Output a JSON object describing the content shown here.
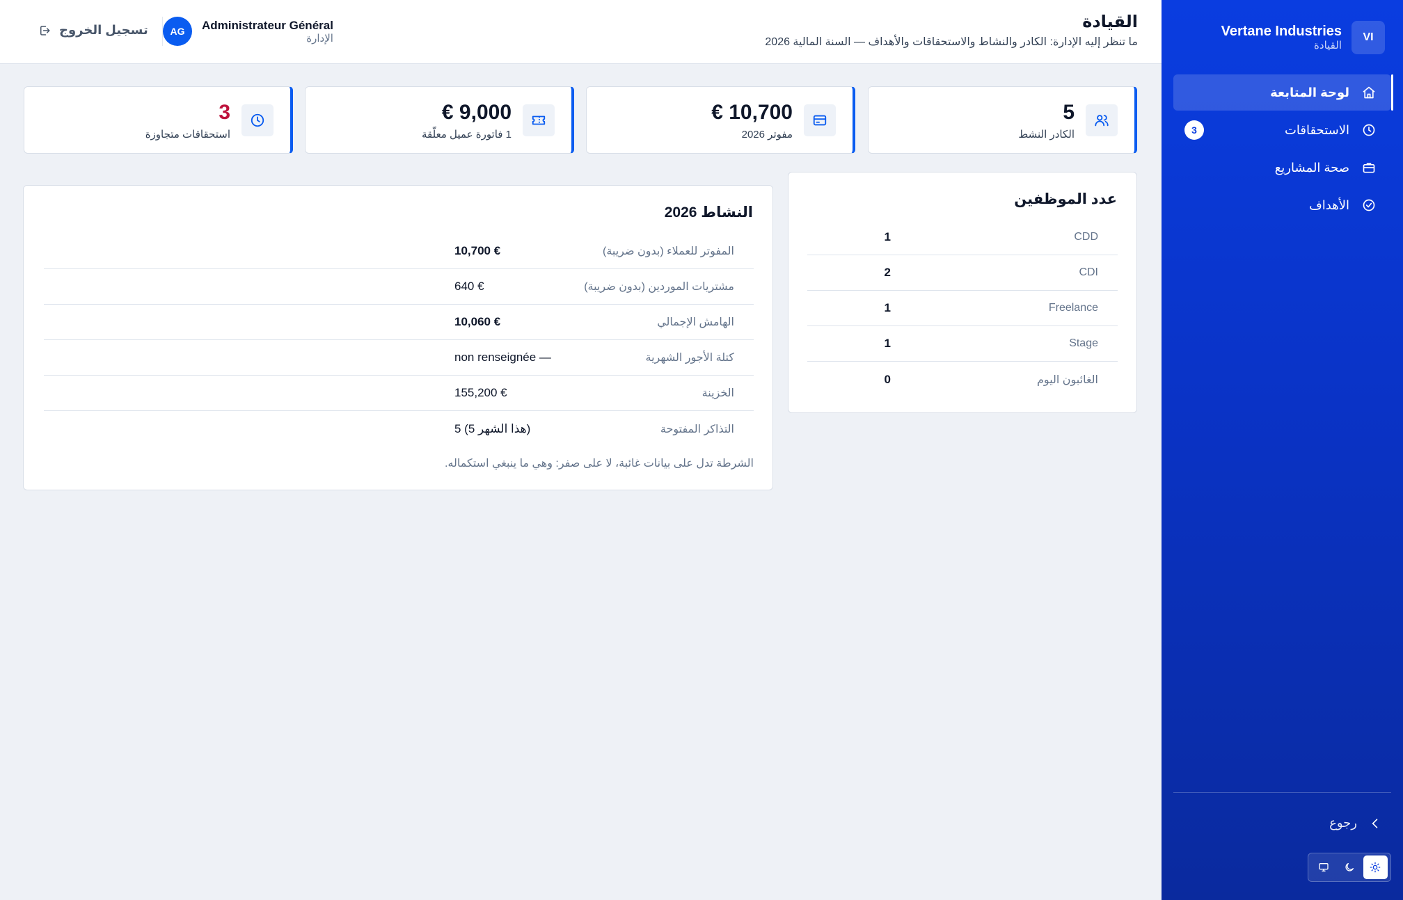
{
  "sidebar": {
    "brand_initials": "VI",
    "brand_name": "Vertane Industries",
    "brand_sub": "القيادة",
    "items": [
      {
        "label": "لوحة المتابعة",
        "icon": "home-icon",
        "active": true
      },
      {
        "label": "الاستحقاقات",
        "icon": "clock-icon",
        "badge": "3"
      },
      {
        "label": "صحة المشاريع",
        "icon": "briefcase-icon"
      },
      {
        "label": "الأهداف",
        "icon": "check-circle-icon"
      }
    ],
    "back_label": "رجوع",
    "theme_options": [
      "light",
      "dark",
      "system"
    ],
    "theme_selected": "light"
  },
  "header": {
    "title": "القيادة",
    "subtitle": "ما تنظر إليه الإدارة: الكادر والنشاط والاستحقاقات والأهداف — السنة المالية 2026",
    "user_initials": "AG",
    "user_name": "Administrateur Général",
    "user_role": "الإدارة",
    "logout_label": "تسجيل الخروج"
  },
  "stats": [
    {
      "value": "5",
      "label": "الكادر النشط",
      "icon": "users-icon"
    },
    {
      "value": "€ 10,700",
      "label": "مفوتر 2026",
      "icon": "credit-card-icon"
    },
    {
      "value": "€ 9,000",
      "label": "1 فاتورة عميل معلّقة",
      "icon": "ticket-icon"
    },
    {
      "value": "3",
      "label": "استحقاقات متجاوزة",
      "icon": "clock-icon",
      "alert": true
    }
  ],
  "headcount": {
    "title": "عدد الموظفين",
    "rows": [
      {
        "label": "CDD",
        "value": "1"
      },
      {
        "label": "CDI",
        "value": "2"
      },
      {
        "label": "Freelance",
        "value": "1"
      },
      {
        "label": "Stage",
        "value": "1"
      },
      {
        "label": "الغائبون اليوم",
        "value": "0"
      }
    ]
  },
  "activity": {
    "title": "النشاط 2026",
    "rows": [
      {
        "label": "المفوتر للعملاء (بدون ضريبة)",
        "value": "€ 10,700",
        "bold": true
      },
      {
        "label": "مشتريات الموردين (بدون ضريبة)",
        "value": "€ 640",
        "bold": false
      },
      {
        "label": "الهامش الإجمالي",
        "value": "€ 10,060",
        "bold": true
      },
      {
        "label": "كتلة الأجور الشهرية",
        "value": "non renseignée —",
        "bold": false
      },
      {
        "label": "الخزينة",
        "value": "€ 155,200",
        "bold": false
      },
      {
        "label": "التذاكر المفتوحة",
        "value": "5 (5 هذا الشهر)",
        "bold": false
      }
    ],
    "note": "الشرطة تدل على بيانات غائبة، لا على صفر: وهي ما ينبغي استكماله."
  },
  "colors": {
    "sidebar": "#0a3de0",
    "accent": "#0a5cf0",
    "alert": "#be123c",
    "background": "#eef1f6"
  }
}
